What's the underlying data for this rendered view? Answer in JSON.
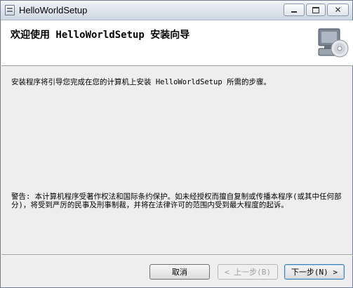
{
  "window": {
    "title": "HelloWorldSetup",
    "controls": {
      "minimize": "minimize",
      "maximize": "maximize",
      "close": "close"
    }
  },
  "banner": {
    "heading": "欢迎使用 HelloWorldSetup 安装向导",
    "icon": "computer-cd-icon"
  },
  "body": {
    "intro": "安装程序将引导您完成在您的计算机上安装 HelloWorldSetup 所需的步骤。",
    "warning": "警告: 本计算机程序受著作权法和国际条约保护。如未经授权而擅自复制或传播本程序(或其中任何部分)，将受到严厉的民事及刑事制裁，并将在法律许可的范围内受到最大程度的起诉。"
  },
  "buttons": {
    "cancel": "取消",
    "back": "< 上一步(B)",
    "next": "下一步(N) >"
  }
}
